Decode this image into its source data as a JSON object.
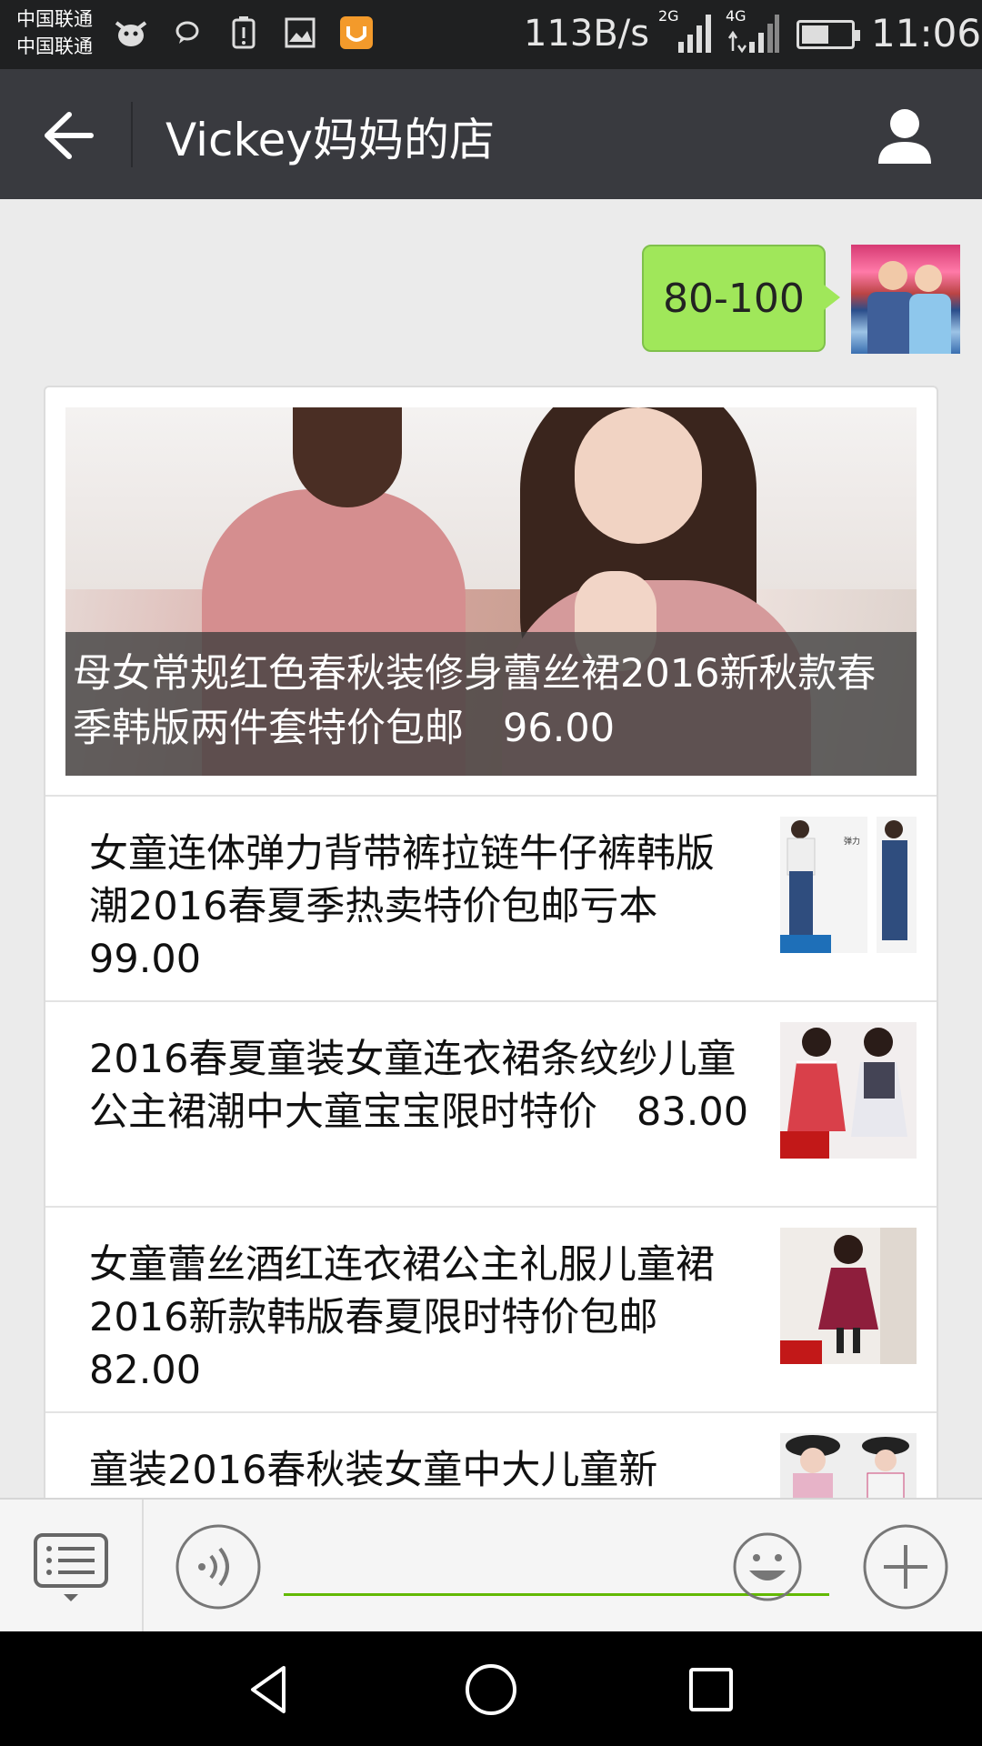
{
  "status_bar": {
    "carrier_1": "中国联通",
    "carrier_2": "中国联通",
    "network_speed": "113B/s",
    "signal_1_label": "2G",
    "signal_2_label": "4G",
    "time": "11:06",
    "battery_level": 0.55
  },
  "header": {
    "title": "Vickey妈妈的店"
  },
  "chat": {
    "sent_message": "80-100",
    "products": [
      {
        "caption": "母女常规红色春秋装修身蕾丝裙2016新秋款春季韩版两件套特价包邮　96.00"
      },
      {
        "caption": "女童连体弹力背带裤拉链牛仔裤韩版潮2016春夏季热卖特价包邮亏本　99.00"
      },
      {
        "caption": "2016春夏童装女童连衣裙条纹纱儿童公主裙潮中大童宝宝限时特价　83.00"
      },
      {
        "caption": "女童蕾丝酒红连衣裙公主礼服儿童裙2016新款韩版春夏限时特价包邮　82.00"
      },
      {
        "caption": "童装2016春秋装女童中大儿童新"
      }
    ]
  },
  "input": {
    "placeholder": ""
  },
  "colors": {
    "status_bar_bg": "#1f2021",
    "title_bar_bg": "#393a3f",
    "chat_bg": "#ebebeb",
    "bubble_green": "#a0e75a",
    "input_underline": "#62b900"
  }
}
